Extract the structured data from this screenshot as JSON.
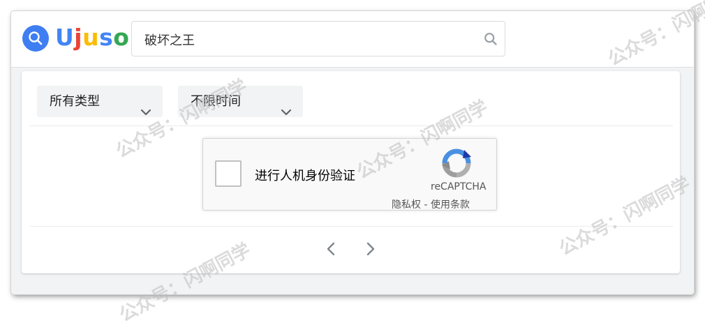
{
  "app": {
    "logo_letters": [
      "U",
      "j",
      "u",
      "s",
      "o"
    ],
    "logo_colors": [
      "#4285f4",
      "#ea4335",
      "#fbbc05",
      "#4285f4",
      "#34a853"
    ]
  },
  "search": {
    "value": "破坏之王",
    "icon": "search-icon"
  },
  "filters": [
    {
      "label": "所有类型",
      "icon": "chevron-down-icon"
    },
    {
      "label": "不限时间",
      "icon": "chevron-down-icon"
    }
  ],
  "recaptcha": {
    "label": "进行人机身份验证",
    "brand": "reCAPTCHA",
    "privacy": "隐私权",
    "separator": "-",
    "terms": "使用条款"
  },
  "pagination": {
    "prev_icon": "chevron-left-icon",
    "next_icon": "chevron-right-icon"
  },
  "watermark": {
    "text": "公众号：闪啊同学"
  }
}
